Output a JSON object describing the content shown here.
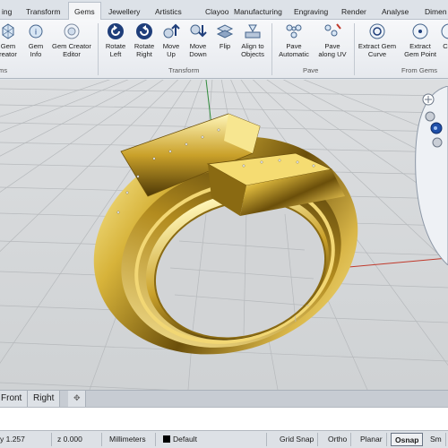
{
  "ribbon_tabs": [
    "ing",
    "Transform",
    "Gems",
    "Jewellery",
    "Artistics",
    "Clayoo",
    "Manufacturing",
    "Engraving",
    "Render",
    "Analyse",
    "Dimen"
  ],
  "active_tab": "Gems",
  "tools": {
    "gem_creator": [
      "Gem",
      "reator"
    ],
    "gem_info": [
      "Gem",
      "Info"
    ],
    "gem_creator_editor": [
      "Gem Creator",
      "Editor"
    ],
    "rotate_left": [
      "Rotate",
      "Left"
    ],
    "rotate_right": [
      "Rotate",
      "Right"
    ],
    "move_up": [
      "Move",
      "Up"
    ],
    "move_down": [
      "Move",
      "Down"
    ],
    "flip": [
      "Flip"
    ],
    "align_to_objects": [
      "Align to",
      "Objects"
    ],
    "pave_automatic": [
      "Pave",
      "Automatic"
    ],
    "pave_along_uv": [
      "Pave",
      "along UV"
    ],
    "extract_gem_curve": [
      "Extract Gem",
      "Curve"
    ],
    "extract_gem_point": [
      "Extract",
      "Gem Point"
    ],
    "cut": [
      "C"
    ]
  },
  "groups": {
    "gems": "ms",
    "transform": "Transform",
    "pave": "Pave",
    "from_gems": "From Gems"
  },
  "viewport_tabs": [
    "Front",
    "Right"
  ],
  "status": {
    "coords": "y 1.257",
    "z": "z 0.000",
    "units": "Millimeters",
    "layer": "Default",
    "grid_snap": "Grid Snap",
    "ortho": "Ortho",
    "planar": "Planar",
    "osnap": "Osnap",
    "smart": "Sm"
  },
  "colors": {
    "gold_light": "#f6e27a",
    "gold_mid": "#c9a227",
    "gold_dark": "#5a4208",
    "grid_line": "#b9bcbf",
    "axis_red": "#c0392b",
    "axis_green": "#2e8b3a",
    "accent_blue": "#1f4fa8"
  }
}
